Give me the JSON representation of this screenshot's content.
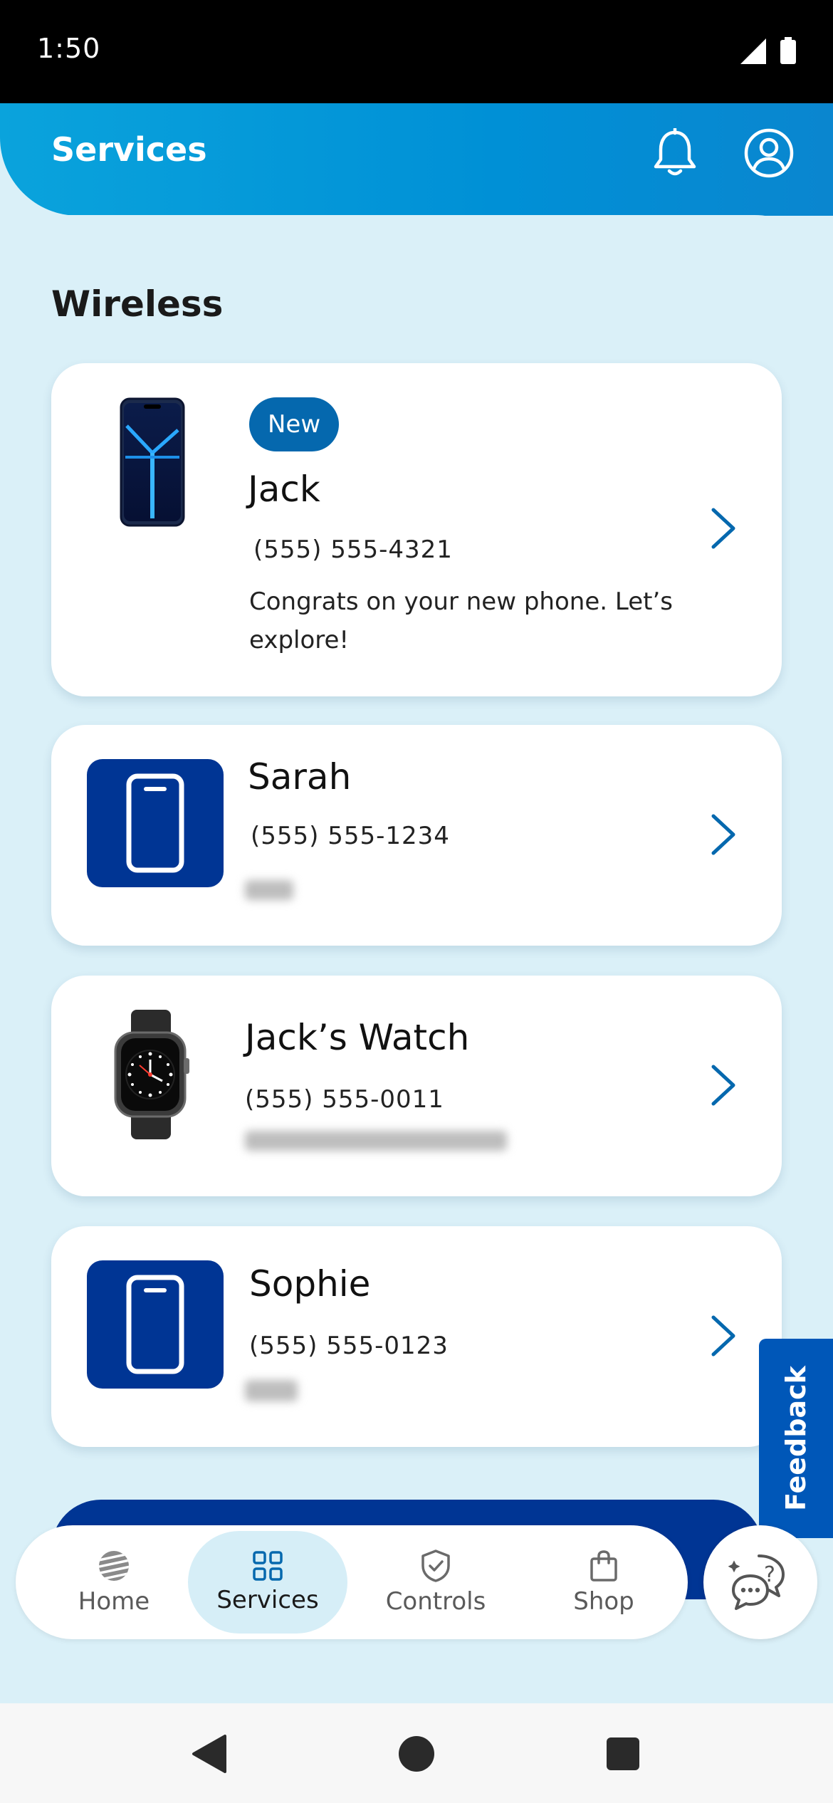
{
  "status_bar": {
    "time": "1:50"
  },
  "header": {
    "title": "Services"
  },
  "section": {
    "title": "Wireless"
  },
  "devices": [
    {
      "badge": "New",
      "name": "Jack",
      "phone": "(555) 555-4321",
      "description": "Congrats on your new phone. Let’s explore!",
      "image": "smartphone-image"
    },
    {
      "name": "Sarah",
      "phone": "(555) 555-1234",
      "image": "phone-tile-icon"
    },
    {
      "name": "Jack’s Watch",
      "phone": "(555) 555-0011",
      "image": "smartwatch-image"
    },
    {
      "name": "Sophie",
      "phone": "(555) 555-0123",
      "image": "phone-tile-icon"
    }
  ],
  "feedback": {
    "label": "Feedback"
  },
  "nav": {
    "items": [
      {
        "label": "Home",
        "icon": "att-globe-icon"
      },
      {
        "label": "Services",
        "icon": "grid-icon",
        "active": true
      },
      {
        "label": "Controls",
        "icon": "shield-check-icon"
      },
      {
        "label": "Shop",
        "icon": "shopping-bag-icon"
      }
    ]
  },
  "colors": {
    "header": "#0096d6",
    "background": "#daf0f8",
    "tile": "#003594",
    "badge": "#0568ae",
    "feedback": "#0057b8",
    "accent": "#0568ae"
  }
}
